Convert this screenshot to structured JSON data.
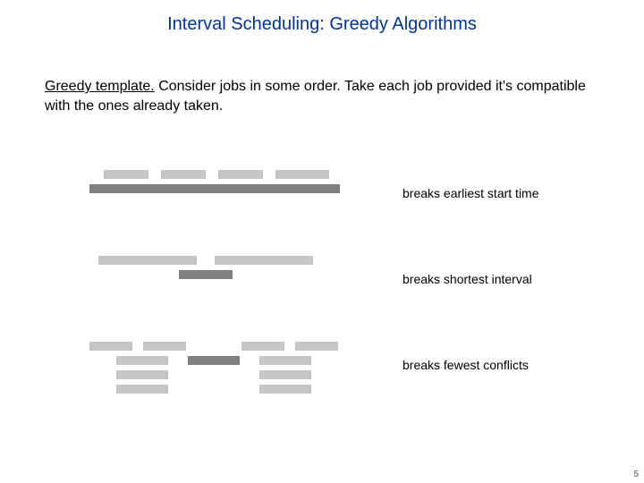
{
  "title": "Interval Scheduling:  Greedy Algorithms",
  "body": {
    "lead": "Greedy template.",
    "rest": "Consider jobs in some order. Take each job provided it's compatible with the ones already taken."
  },
  "examples": {
    "ex1": {
      "caption": "breaks earliest start time"
    },
    "ex2": {
      "caption": "breaks shortest interval"
    },
    "ex3": {
      "caption": "breaks fewest conflicts"
    }
  },
  "page_number": "5"
}
